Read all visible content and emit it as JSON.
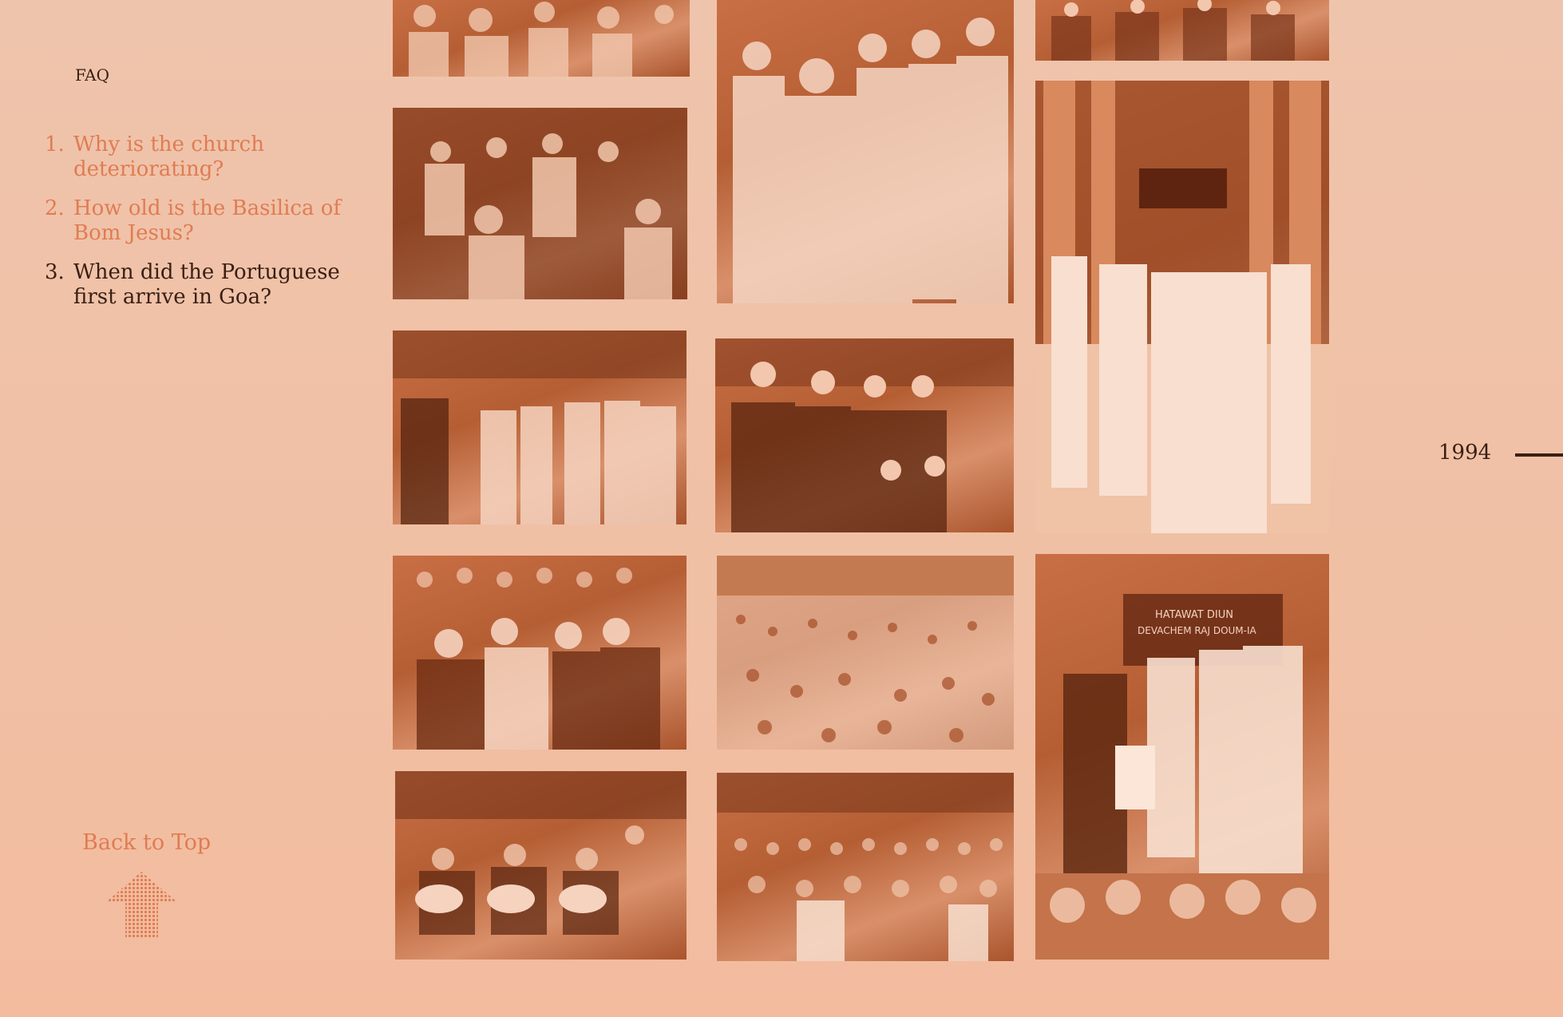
{
  "faq": {
    "label": "FAQ",
    "items": [
      {
        "number": "1.",
        "text": "Why is the church deteriorating?",
        "active": false
      },
      {
        "number": "2.",
        "text": "How old is the Basilica of Bom Jesus?",
        "active": false
      },
      {
        "number": "3.",
        "text": "When did the Portuguese first arrive in Goa?",
        "active": true
      }
    ]
  },
  "back_to_top": {
    "label": "Back to Top",
    "icon": "dotted-up-arrow-icon"
  },
  "timeline": {
    "year": "1994"
  },
  "photos": [
    {
      "name": "photo-seated-congregation"
    },
    {
      "name": "photo-nuns-procession"
    },
    {
      "name": "photo-men-in-suits"
    },
    {
      "name": "photo-violin-choir"
    },
    {
      "name": "photo-basilica-altar"
    },
    {
      "name": "photo-choir-singers"
    },
    {
      "name": "photo-men-with-children"
    },
    {
      "name": "photo-seated-dignitaries"
    },
    {
      "name": "photo-outdoor-crowd"
    },
    {
      "name": "photo-bishop-ceremony",
      "banner_text": [
        "HATAWAT DIUN",
        "DEVACHEM RAJ DOUM-IA"
      ]
    },
    {
      "name": "photo-guitar-players"
    },
    {
      "name": "photo-tent-audience"
    }
  ],
  "colors": {
    "accent": "#e07c52",
    "text": "#3a1f14",
    "background": "#efc4ac",
    "photo_tint": "#c26a40"
  }
}
